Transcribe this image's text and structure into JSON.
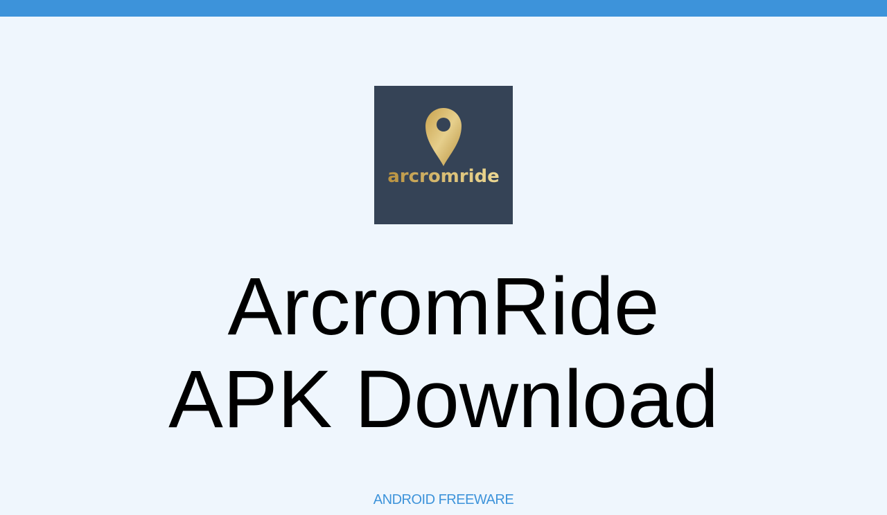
{
  "colors": {
    "top_bar": "#3d93da",
    "background": "#eff6fd",
    "icon_background": "#354356",
    "logo_gold": "#d4b468",
    "title_text": "#000000",
    "link": "#3d93da"
  },
  "app_icon": {
    "icon_name": "location-pin-icon",
    "logo_text": "arcromride"
  },
  "title": {
    "line1": "ArcromRide",
    "line2": "APK Download"
  },
  "footer": {
    "link_label": "ANDROID FREEWARE"
  }
}
